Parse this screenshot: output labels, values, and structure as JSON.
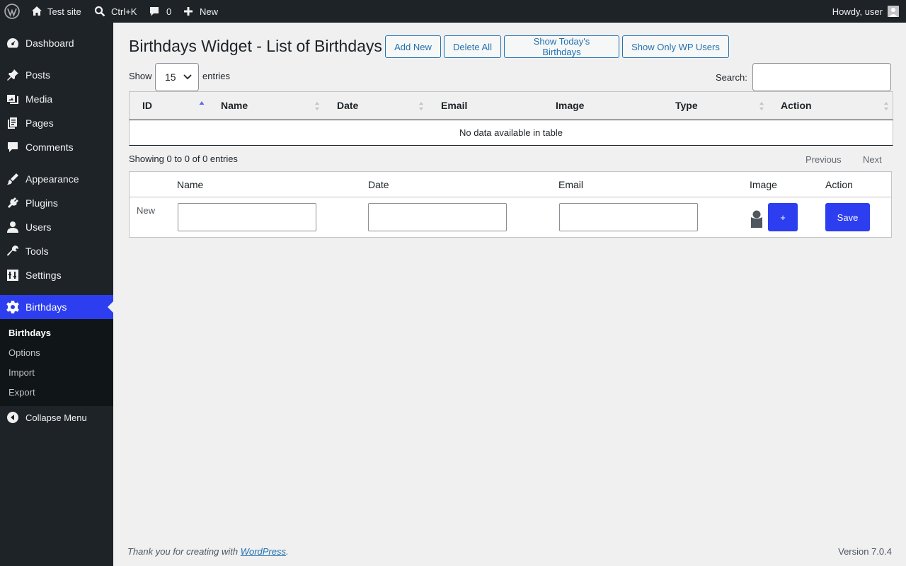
{
  "adminbar": {
    "site_name": "Test site",
    "search_shortcut": "Ctrl+K",
    "comments_count": "0",
    "new_label": "New",
    "howdy": "Howdy, user"
  },
  "sidebar": {
    "items": [
      {
        "label": "Dashboard",
        "icon": "dashboard-icon"
      },
      {
        "label": "Posts",
        "icon": "pin-icon"
      },
      {
        "label": "Media",
        "icon": "media-icon"
      },
      {
        "label": "Pages",
        "icon": "pages-icon"
      },
      {
        "label": "Comments",
        "icon": "comment-icon"
      },
      {
        "label": "Appearance",
        "icon": "brush-icon"
      },
      {
        "label": "Plugins",
        "icon": "plugin-icon"
      },
      {
        "label": "Users",
        "icon": "user-icon"
      },
      {
        "label": "Tools",
        "icon": "wrench-icon"
      },
      {
        "label": "Settings",
        "icon": "settings-icon"
      },
      {
        "label": "Birthdays",
        "icon": "gear-icon"
      }
    ],
    "submenu": [
      "Birthdays",
      "Options",
      "Import",
      "Export"
    ],
    "collapse": "Collapse Menu"
  },
  "page": {
    "title": "Birthdays Widget - List of Birthdays",
    "buttons": {
      "add_new": "Add New",
      "delete_all": "Delete All",
      "today": "Show Today's Birthdays",
      "wp_users": "Show Only WP Users"
    }
  },
  "datatable": {
    "show_label": "Show",
    "entries_label": "entries",
    "page_length": "15",
    "search_label": "Search:",
    "columns": [
      "ID",
      "Name",
      "Date",
      "Email",
      "Image",
      "Type",
      "Action"
    ],
    "empty_message": "No data available in table",
    "info": "Showing 0 to 0 of 0 entries",
    "previous": "Previous",
    "next": "Next"
  },
  "new_form": {
    "columns": [
      "Name",
      "Date",
      "Email",
      "Image",
      "Action"
    ],
    "row_label": "New",
    "add_image": "+",
    "save": "Save"
  },
  "footer": {
    "thanks_prefix": "Thank you for creating with ",
    "wp_link": "WordPress",
    "thanks_suffix": ".",
    "version": "Version 7.0.4"
  },
  "colors": {
    "accent": "#2c3ef0",
    "sidebar_bg": "#1d2327",
    "submenu_bg": "#101517",
    "link": "#2271b1"
  }
}
